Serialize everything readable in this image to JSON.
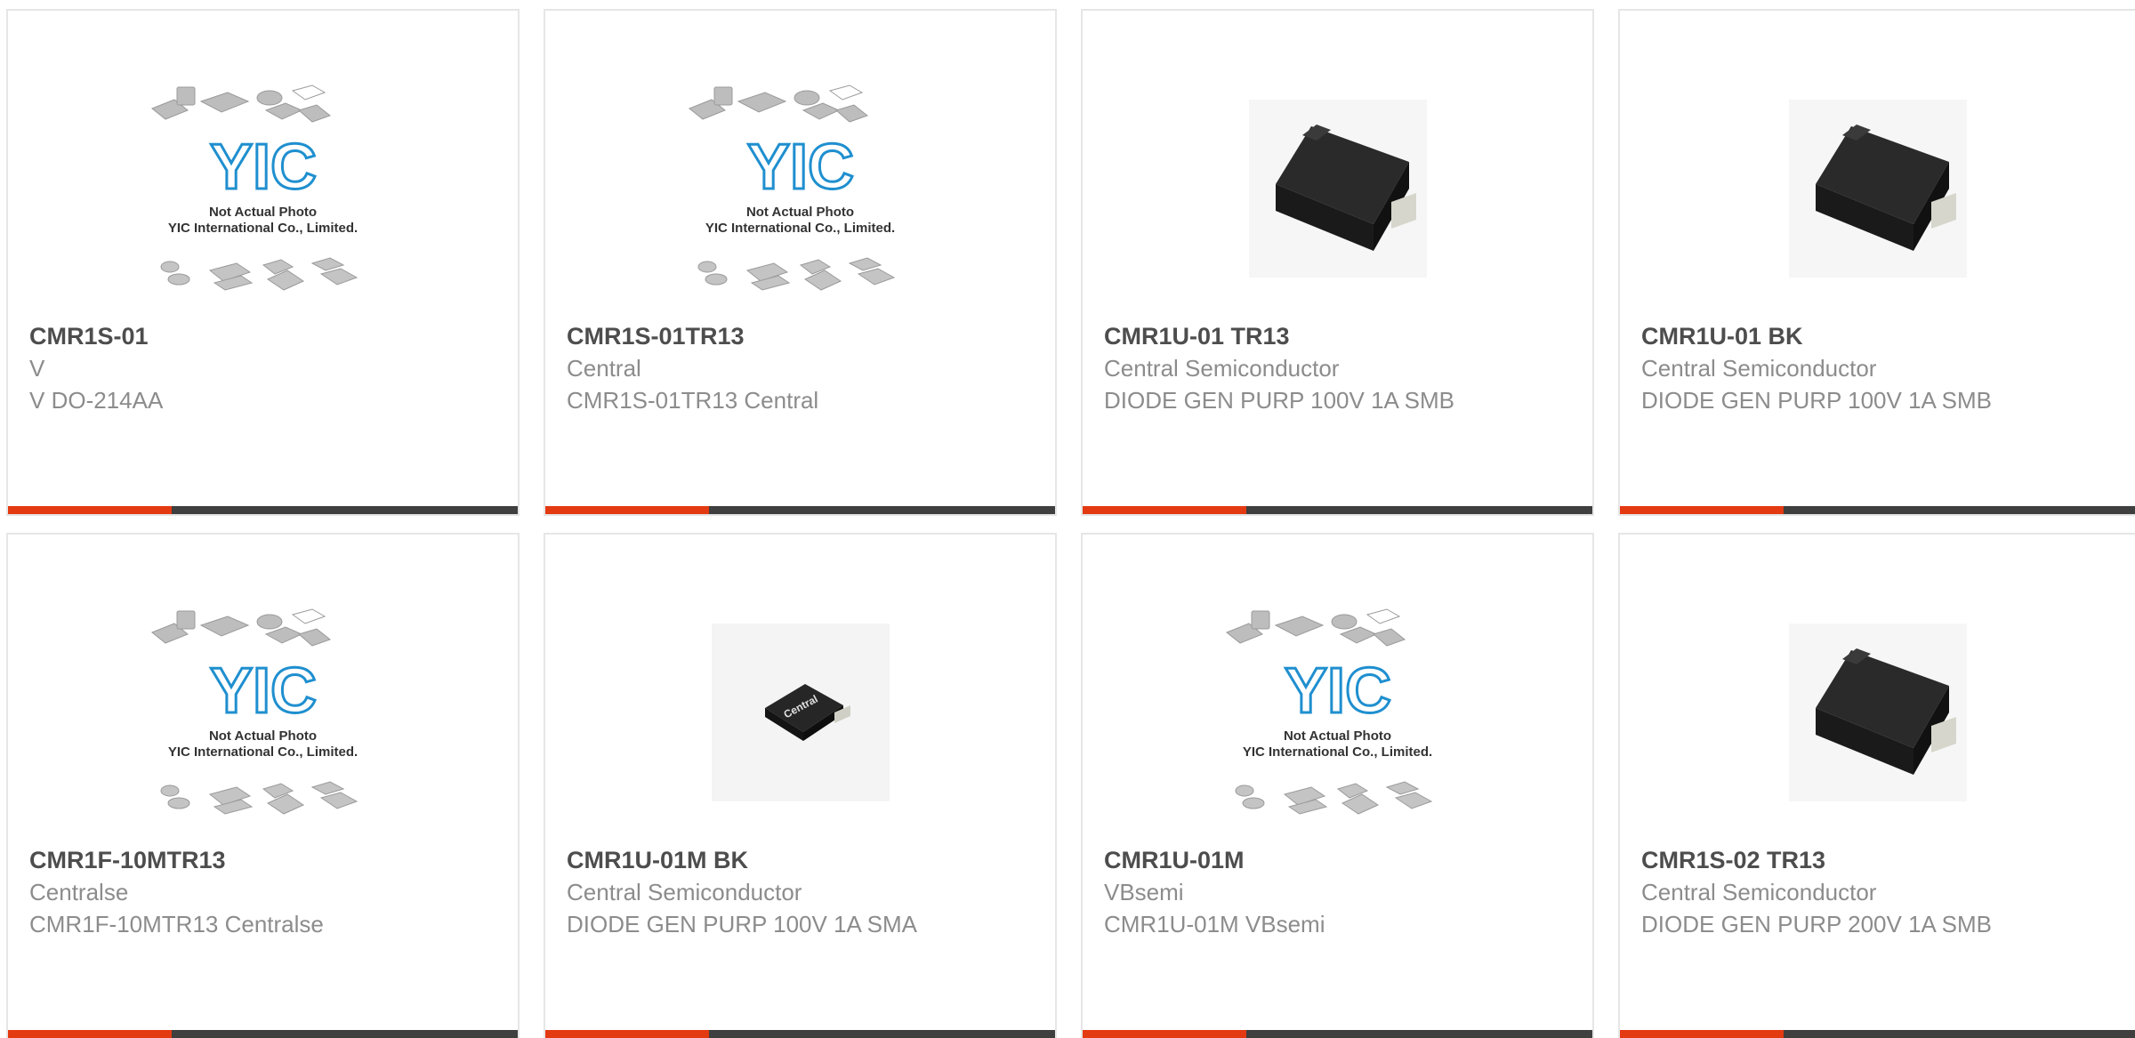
{
  "colors": {
    "accent": "#e33a12",
    "bar": "#3f3f3f",
    "border": "#e6e6e6",
    "title": "#4d4d4d",
    "text": "#8c8c8c",
    "logo": "#1f8fcf"
  },
  "placeholder": {
    "line1": "Not Actual Photo",
    "line2": "YIC International Co., Limited.",
    "logo_text": "YIC"
  },
  "products": [
    {
      "part": "CMR1S-01",
      "maker": "V",
      "desc": "V DO-214AA",
      "image": "yic-placeholder"
    },
    {
      "part": "CMR1S-01TR13",
      "maker": "Central",
      "desc": "CMR1S-01TR13 Central",
      "image": "yic-placeholder"
    },
    {
      "part": "CMR1U-01 TR13",
      "maker": "Central Semiconductor",
      "desc": "DIODE GEN PURP 100V 1A SMB",
      "image": "smb-package-photo"
    },
    {
      "part": "CMR1U-01 BK",
      "maker": "Central Semiconductor",
      "desc": "DIODE GEN PURP 100V 1A SMB",
      "image": "smb-package-photo"
    },
    {
      "part": "CMR1F-10MTR13",
      "maker": "Centralse",
      "desc": "CMR1F-10MTR13 Centralse",
      "image": "yic-placeholder"
    },
    {
      "part": "CMR1U-01M BK",
      "maker": "Central Semiconductor",
      "desc": "DIODE GEN PURP 100V 1A SMA",
      "image": "sma-package-photo",
      "chip_label": "Central"
    },
    {
      "part": "CMR1U-01M",
      "maker": "VBsemi",
      "desc": "CMR1U-01M VBsemi",
      "image": "yic-placeholder"
    },
    {
      "part": "CMR1S-02 TR13",
      "maker": "Central Semiconductor",
      "desc": "DIODE GEN PURP 200V 1A SMB",
      "image": "smb-package-photo"
    }
  ]
}
